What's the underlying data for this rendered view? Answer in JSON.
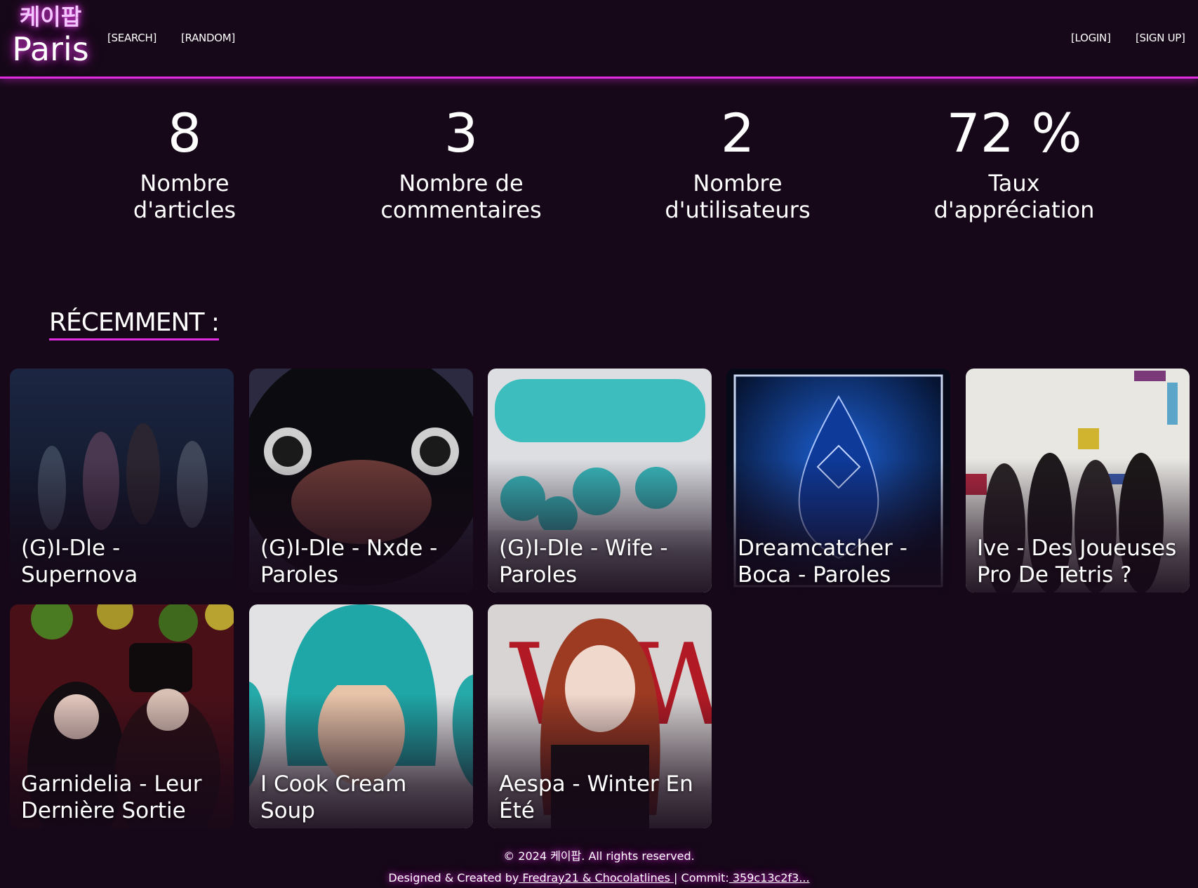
{
  "header": {
    "logo_korean": "케이팝",
    "logo_city": "Paris",
    "nav_left": [
      "[SEARCH]",
      "[RANDOM]"
    ],
    "nav_right": [
      "[LOGIN]",
      "[SIGN UP]"
    ]
  },
  "stats": [
    {
      "value": "8",
      "label_line1": "Nombre",
      "label_line2": "d'articles"
    },
    {
      "value": "3",
      "label_line1": "Nombre de",
      "label_line2": "commentaires"
    },
    {
      "value": "2",
      "label_line1": "Nombre",
      "label_line2": "d'utilisateurs"
    },
    {
      "value": "72 %",
      "label_line1": "Taux",
      "label_line2": "d'appréciation"
    }
  ],
  "recent": {
    "title": "RÉCEMMENT :",
    "articles": [
      {
        "title": "(G)I-Dle - Supernova",
        "palette": "#1a2238"
      },
      {
        "title": "(G)I-Dle - Nxde - Paroles",
        "palette": "#0d0d14"
      },
      {
        "title": "(G)I-Dle - Wife - Paroles",
        "palette": "#d8dadd"
      },
      {
        "title": "Dreamcatcher - Boca - Paroles",
        "palette": "#0c2a6a"
      },
      {
        "title": "Ive - Des Joueuses Pro De Tetris ?",
        "palette": "#e9e9e4"
      },
      {
        "title": "Garnidelia - Leur Dernière Sortie",
        "palette": "#5a141c"
      },
      {
        "title": "I Cook Cream Soup",
        "palette": "#e4e4e6"
      },
      {
        "title": "Aespa - Winter En Été",
        "palette": "#d9d4d3"
      }
    ]
  },
  "footer": {
    "copyright": "© 2024 케이팝. All rights reserved.",
    "credit_prefix": "Designed & Created by",
    "credit_authors": " Fredray21 & Chocolatlines ",
    "commit_prefix": "| Commit:",
    "commit_hash": " 359c13c2f3..."
  },
  "colors": {
    "background": "#160818",
    "accent": "#e02ce0",
    "text": "#ffffff"
  }
}
